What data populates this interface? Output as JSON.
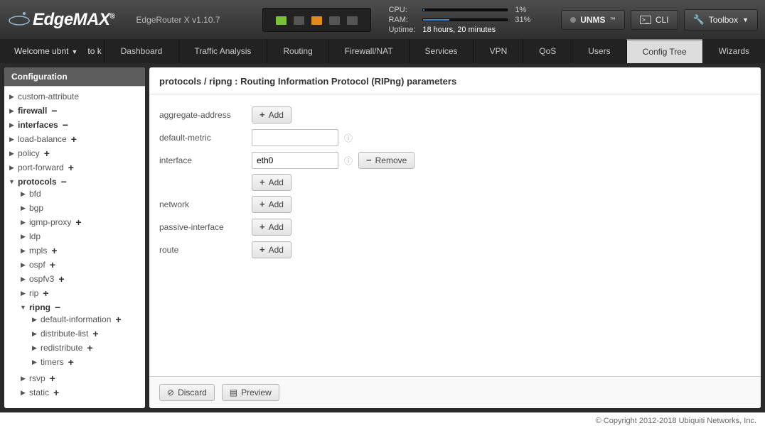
{
  "header": {
    "product": "EdgeMAX",
    "model_version": "EdgeRouter X v1.10.7",
    "ports": [
      "green",
      "off",
      "orange",
      "off",
      "off"
    ],
    "stats": {
      "cpu_label": "CPU:",
      "cpu_pct": "1%",
      "cpu_fill": 1,
      "ram_label": "RAM:",
      "ram_pct": "31%",
      "ram_fill": 31,
      "uptime_label": "Uptime:",
      "uptime": "18 hours, 20 minutes"
    },
    "buttons": {
      "unms": "UNMS",
      "cli": "CLI",
      "toolbox": "Toolbox"
    }
  },
  "nav": {
    "welcome": "Welcome ubnt",
    "to_site": "to kap",
    "tabs": [
      "Dashboard",
      "Traffic Analysis",
      "Routing",
      "Firewall/NAT",
      "Services",
      "VPN",
      "QoS",
      "Users",
      "Config Tree",
      "Wizards"
    ],
    "active": "Config Tree"
  },
  "sidebar": {
    "title": "Configuration",
    "tree": [
      {
        "label": "custom-attribute",
        "caret": "▶"
      },
      {
        "label": "firewall",
        "caret": "▶",
        "bold": true,
        "pm": "−"
      },
      {
        "label": "interfaces",
        "caret": "▶",
        "bold": true,
        "pm": "−"
      },
      {
        "label": "load-balance",
        "caret": "▶",
        "pm": "+"
      },
      {
        "label": "policy",
        "caret": "▶",
        "pm": "+"
      },
      {
        "label": "port-forward",
        "caret": "▶",
        "pm": "+"
      },
      {
        "label": "protocols",
        "caret": "▼",
        "bold": true,
        "pm": "−",
        "children": [
          {
            "label": "bfd",
            "caret": "▶"
          },
          {
            "label": "bgp",
            "caret": "▶"
          },
          {
            "label": "igmp-proxy",
            "caret": "▶",
            "pm": "+"
          },
          {
            "label": "ldp",
            "caret": "▶"
          },
          {
            "label": "mpls",
            "caret": "▶",
            "pm": "+"
          },
          {
            "label": "ospf",
            "caret": "▶",
            "pm": "+"
          },
          {
            "label": "ospfv3",
            "caret": "▶",
            "pm": "+"
          },
          {
            "label": "rip",
            "caret": "▶",
            "pm": "+"
          },
          {
            "label": "ripng",
            "caret": "▼",
            "bold": true,
            "pm": "−",
            "children": [
              {
                "label": "default-information",
                "caret": "▶",
                "pm": "+"
              },
              {
                "label": "distribute-list",
                "caret": "▶",
                "pm": "+"
              },
              {
                "label": "redistribute",
                "caret": "▶",
                "pm": "+"
              },
              {
                "label": "timers",
                "caret": "▶",
                "pm": "+"
              }
            ]
          },
          {
            "label": "rsvp",
            "caret": "▶",
            "pm": "+"
          },
          {
            "label": "static",
            "caret": "▶",
            "pm": "+"
          }
        ]
      }
    ]
  },
  "main": {
    "breadcrumb": "protocols / ripng :",
    "breadcrumb_desc": "Routing Information Protocol (RIPng) parameters",
    "labels": {
      "aggregate_address": "aggregate-address",
      "default_metric": "default-metric",
      "interface": "interface",
      "network": "network",
      "passive_interface": "passive-interface",
      "route": "route"
    },
    "values": {
      "default_metric": "",
      "interface": "eth0"
    },
    "buttons": {
      "add": "Add",
      "remove": "Remove",
      "discard": "Discard",
      "preview": "Preview"
    }
  },
  "footer": {
    "copyright": "© Copyright 2012-2018 Ubiquiti Networks, Inc."
  }
}
